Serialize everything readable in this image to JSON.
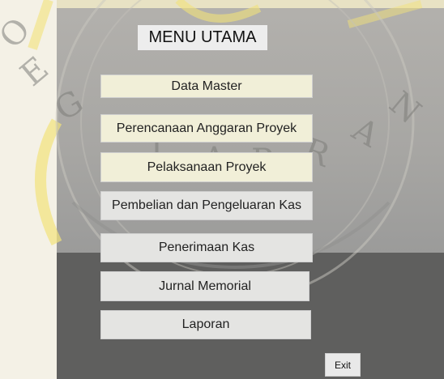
{
  "title": "MENU UTAMA",
  "menu": [
    {
      "label": "Data Master"
    },
    {
      "label": "Perencanaan Anggaran Proyek"
    },
    {
      "label": "Pelaksanaan Proyek"
    },
    {
      "label": "Pembelian dan Pengeluaran Kas"
    },
    {
      "label": "Penerimaan Kas"
    },
    {
      "label": "Jurnal Memorial"
    },
    {
      "label": "Laporan"
    }
  ],
  "exit_label": "Exit",
  "watermark_letters": [
    "O",
    "E",
    "G",
    "J",
    "A",
    "P",
    "R",
    "A",
    "N"
  ],
  "colors": {
    "upper_panel": "#a9a8a5",
    "lower_panel": "#5f5f5e",
    "button_light": "#f1efd8",
    "button_grey": "#e4e4e2",
    "watermark_yellow": "#f2e27a"
  }
}
